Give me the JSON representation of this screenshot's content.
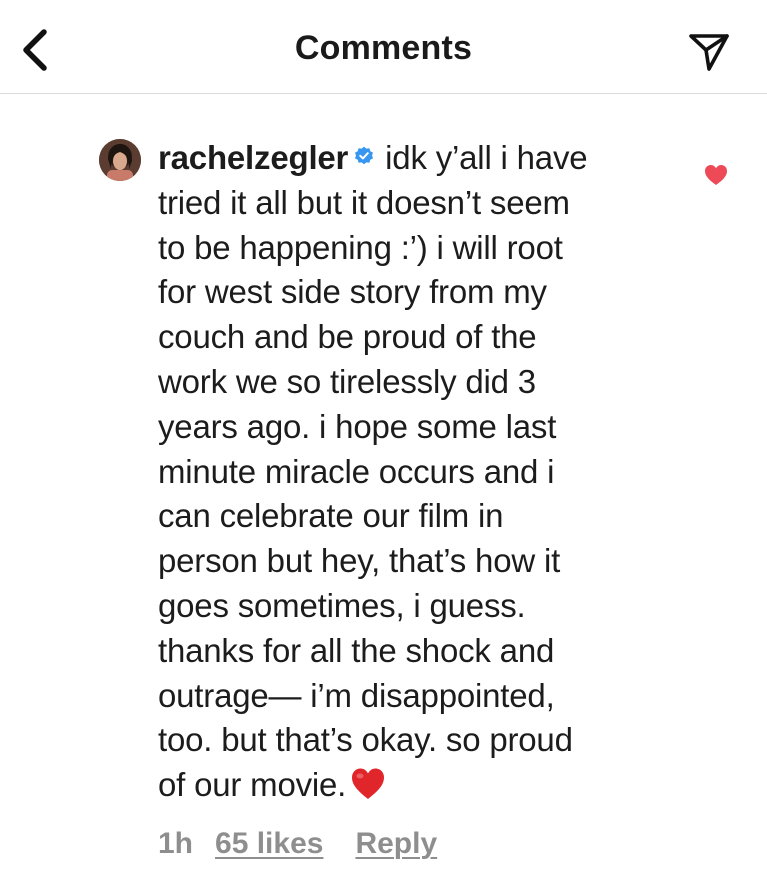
{
  "header": {
    "title": "Comments",
    "back_icon": "chevron-left-icon",
    "share_icon": "paper-plane-icon"
  },
  "comment": {
    "username": "rachelzegler",
    "verified": true,
    "verified_color": "#3797f0",
    "liked": true,
    "like_color": "#ed4956",
    "lines": [
      "idk y’all i have",
      "tried it all but it doesn’t seem",
      "to be happening :’) i will root",
      "for west side story from my",
      "couch and be proud of the",
      "work we so tirelessly did 3",
      "years ago. i hope some last",
      "minute miracle occurs and i",
      "can celebrate our film in",
      "person but hey, that’s how it",
      "goes sometimes, i guess.",
      "thanks for all the shock and",
      "outrage— i’m disappointed,",
      "too. but that’s okay. so proud",
      "of our movie."
    ],
    "emoji": "red-heart-emoji",
    "time": "1h",
    "likes": "65 likes",
    "reply_label": "Reply"
  }
}
